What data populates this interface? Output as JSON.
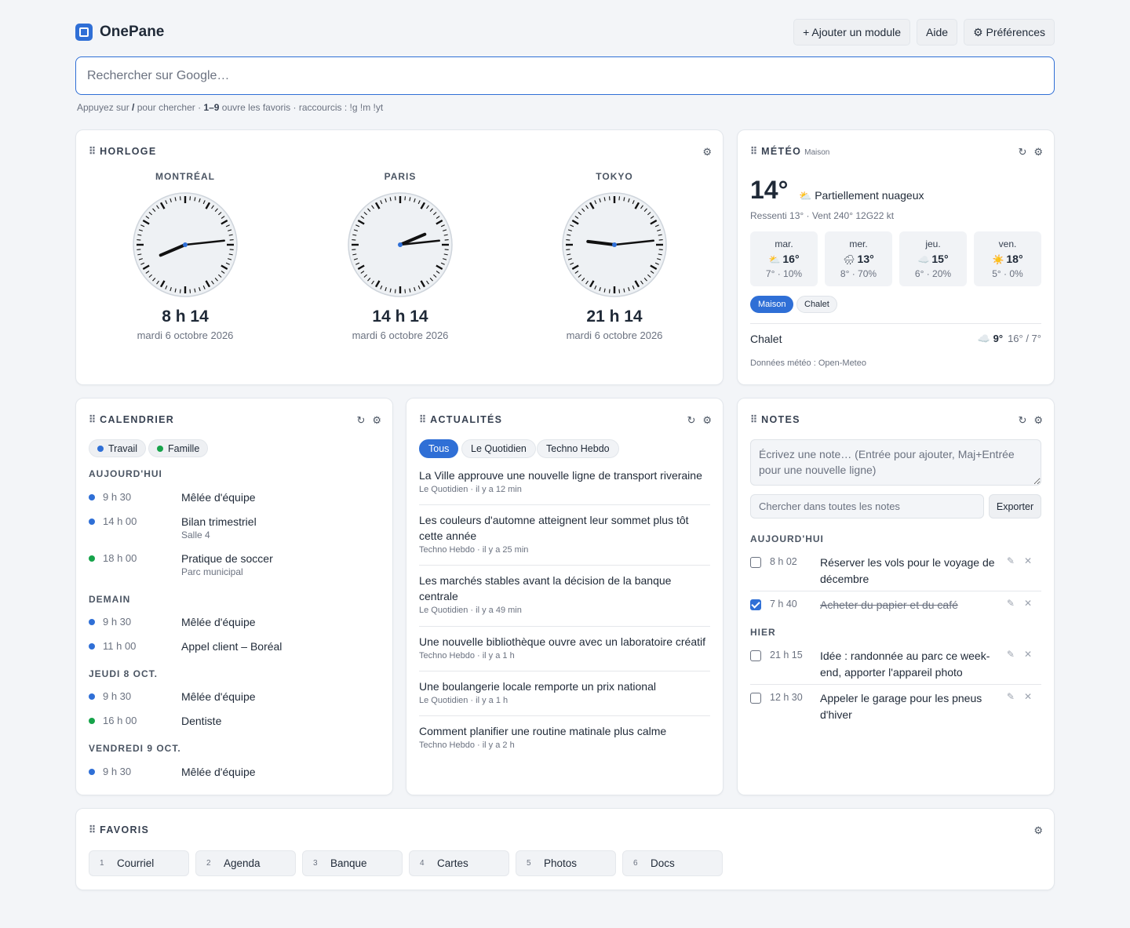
{
  "app": {
    "title": "OnePane"
  },
  "header": {
    "add_module": "+ Ajouter un module",
    "help": "Aide",
    "prefs": "⚙ Préférences"
  },
  "search": {
    "placeholder": "Rechercher sur Google…"
  },
  "hint": {
    "a": "Appuyez sur ",
    "b": "/",
    "c": " pour chercher · ",
    "d": "1–9",
    "e": " ouvre les favoris · raccourcis : !g !m !yt"
  },
  "clock": {
    "title": "HORLOGE",
    "cities": [
      {
        "city": "MONTRÉAL",
        "time": "8 h 14",
        "date": "mardi 6 octobre 2026",
        "h": 8,
        "m": 14
      },
      {
        "city": "PARIS",
        "time": "14 h 14",
        "date": "mardi 6 octobre 2026",
        "h": 14,
        "m": 14
      },
      {
        "city": "TOKYO",
        "time": "21 h 14",
        "date": "mardi 6 octobre 2026",
        "h": 21,
        "m": 14
      }
    ]
  },
  "weather": {
    "title": "MÉTÉO",
    "location": "Maison",
    "temp": "14°",
    "cond_icon": "⛅",
    "condition": "Partiellement nuageux",
    "feels": "Ressenti 13° · Vent 240° 12G22 kt",
    "forecast": [
      {
        "day": "mar.",
        "icon": "⛅",
        "high": "16°",
        "low": "7° · 10%"
      },
      {
        "day": "mer.",
        "icon": "🌧",
        "high": "13°",
        "low": "8° · 70%"
      },
      {
        "day": "jeu.",
        "icon": "☁️",
        "high": "15°",
        "low": "6° · 20%"
      },
      {
        "day": "ven.",
        "icon": "☀️",
        "high": "18°",
        "low": "5° · 0%"
      }
    ],
    "locations": [
      "Maison",
      "Chalet"
    ],
    "other": {
      "name": "Chalet",
      "icon": "☁️",
      "temp": "9°",
      "range": "16° / 7°"
    },
    "source": "Données météo : Open-Meteo"
  },
  "calendar": {
    "title": "CALENDRIER",
    "tags": [
      {
        "label": "Travail",
        "color": "#2f6fd6"
      },
      {
        "label": "Famille",
        "color": "#16a34a"
      }
    ],
    "days": [
      {
        "label": "AUJOURD'HUI",
        "events": [
          {
            "time": "9 h 30",
            "title": "Mêlée d'équipe",
            "sub": "",
            "color": "#2f6fd6"
          },
          {
            "time": "14 h 00",
            "title": "Bilan trimestriel",
            "sub": "Salle 4",
            "color": "#2f6fd6"
          },
          {
            "time": "18 h 00",
            "title": "Pratique de soccer",
            "sub": "Parc municipal",
            "color": "#16a34a"
          }
        ]
      },
      {
        "label": "DEMAIN",
        "events": [
          {
            "time": "9 h 30",
            "title": "Mêlée d'équipe",
            "sub": "",
            "color": "#2f6fd6"
          },
          {
            "time": "11 h 00",
            "title": "Appel client – Boréal",
            "sub": "",
            "color": "#2f6fd6"
          }
        ]
      },
      {
        "label": "JEUDI 8 OCT.",
        "events": [
          {
            "time": "9 h 30",
            "title": "Mêlée d'équipe",
            "sub": "",
            "color": "#2f6fd6"
          },
          {
            "time": "16 h 00",
            "title": "Dentiste",
            "sub": "",
            "color": "#16a34a"
          }
        ]
      },
      {
        "label": "VENDREDI 9 OCT.",
        "events": [
          {
            "time": "9 h 30",
            "title": "Mêlée d'équipe",
            "sub": "",
            "color": "#2f6fd6"
          }
        ]
      }
    ]
  },
  "news": {
    "title": "ACTUALITÉS",
    "filters": [
      "Tous",
      "Le Quotidien",
      "Techno Hebdo"
    ],
    "items": [
      {
        "title": "La Ville approuve une nouvelle ligne de transport riveraine",
        "meta": "Le Quotidien · il y a 12 min"
      },
      {
        "title": "Les couleurs d'automne atteignent leur sommet plus tôt cette année",
        "meta": "Techno Hebdo · il y a 25 min"
      },
      {
        "title": "Les marchés stables avant la décision de la banque centrale",
        "meta": "Le Quotidien · il y a 49 min"
      },
      {
        "title": "Une nouvelle bibliothèque ouvre avec un laboratoire créatif",
        "meta": "Techno Hebdo · il y a 1 h"
      },
      {
        "title": "Une boulangerie locale remporte un prix national",
        "meta": "Le Quotidien · il y a 1 h"
      },
      {
        "title": "Comment planifier une routine matinale plus calme",
        "meta": "Techno Hebdo · il y a 2 h"
      }
    ]
  },
  "notes": {
    "title": "NOTES",
    "input_placeholder": "Écrivez une note… (Entrée pour ajouter, Maj+Entrée pour une nouvelle ligne)",
    "search_placeholder": "Chercher dans toutes les notes",
    "export": "Exporter",
    "groups": [
      {
        "label": "AUJOURD'HUI",
        "notes": [
          {
            "time": "8 h 02",
            "text": "Réserver les vols pour le voyage de décembre",
            "done": false
          },
          {
            "time": "7 h 40",
            "text": "Acheter du papier et du café",
            "done": true
          }
        ]
      },
      {
        "label": "HIER",
        "notes": [
          {
            "time": "21 h 15",
            "text": "Idée : randonnée au parc ce week-end, apporter l'appareil photo",
            "done": false
          },
          {
            "time": "12 h 30",
            "text": "Appeler le garage pour les pneus d'hiver",
            "done": false
          }
        ]
      }
    ]
  },
  "favorites": {
    "title": "FAVORIS",
    "items": [
      {
        "num": "1",
        "label": "Courriel"
      },
      {
        "num": "2",
        "label": "Agenda"
      },
      {
        "num": "3",
        "label": "Banque"
      },
      {
        "num": "4",
        "label": "Cartes"
      },
      {
        "num": "5",
        "label": "Photos"
      },
      {
        "num": "6",
        "label": "Docs"
      }
    ]
  },
  "icons": {
    "grip": "⠿",
    "refresh": "↻",
    "gear": "⚙",
    "edit": "✎",
    "delete": "✕"
  }
}
